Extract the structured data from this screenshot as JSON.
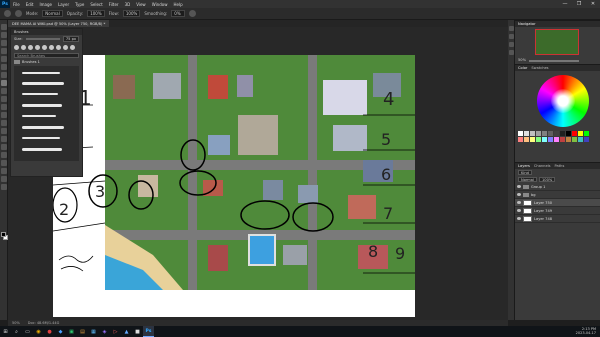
{
  "menubar": {
    "logo": "Ps",
    "items": [
      "File",
      "Edit",
      "Image",
      "Layer",
      "Type",
      "Select",
      "Filter",
      "3D",
      "View",
      "Window",
      "Help"
    ],
    "window_controls": [
      "—",
      "❐",
      "✕"
    ]
  },
  "options": {
    "mode_label": "Mode:",
    "mode_value": "Normal",
    "opacity_label": "Opacity:",
    "opacity_value": "100%",
    "flow_label": "Flow:",
    "flow_value": "100%",
    "smoothing_label": "Smoothing:",
    "smoothing_value": "0%"
  },
  "tab": {
    "title": "DEE MAMA AI WIKI.psd @ 50% (Layer 750, RGB/8) *"
  },
  "brushes": {
    "title": "Brushes",
    "size_label": "Size:",
    "size_value": "75 px",
    "search_placeholder": "Search Brushes",
    "folder_name": "Brushes 1"
  },
  "navigator": {
    "tabs": [
      "Navigator"
    ],
    "zoom": "50%"
  },
  "swatches": {
    "tabs": [
      "Swatches"
    ],
    "colors": [
      "#ffffff",
      "#e0e0e0",
      "#c0c0c0",
      "#a0a0a0",
      "#808080",
      "#606060",
      "#404040",
      "#202020",
      "#000000",
      "#ff0000",
      "#ffff00",
      "#00ff00",
      "#ff8080",
      "#ffc080",
      "#ffff80",
      "#80ff80",
      "#80ffff",
      "#8080ff",
      "#ff80ff",
      "#c04040",
      "#c08040",
      "#80c040",
      "#40c0c0",
      "#4040c0"
    ]
  },
  "color": {
    "tabs": [
      "Color"
    ]
  },
  "layers": {
    "tabs": [
      "Layers",
      "Channels",
      "Paths"
    ],
    "kind_label": "Kind",
    "blend": "Normal",
    "opacity": "100%",
    "items": [
      {
        "name": "Group 1",
        "type": "group"
      },
      {
        "name": "bg",
        "type": "group"
      },
      {
        "name": "Layer 750",
        "type": "layer",
        "selected": true
      },
      {
        "name": "Layer 749",
        "type": "layer"
      },
      {
        "name": "Layer 748",
        "type": "layer"
      }
    ]
  },
  "status": {
    "zoom": "50%",
    "doc": "Doc: 48.6M/1.44G"
  },
  "sketch_numbers": [
    "1",
    "2",
    "3",
    "4",
    "5",
    "6",
    "7",
    "8",
    "9"
  ],
  "taskbar": {
    "apps": [
      "⊞",
      "⌕",
      "▭",
      "◉",
      "●",
      "◆",
      "▣",
      "▤",
      "▦",
      "◈",
      "▷",
      "▲",
      "■",
      "Ps"
    ],
    "time": "2:13 PM",
    "date": "2023-04-17"
  }
}
